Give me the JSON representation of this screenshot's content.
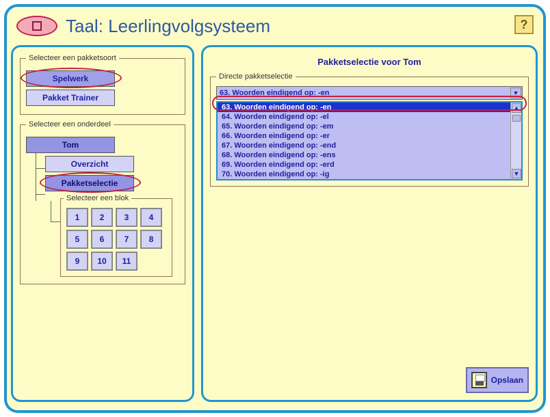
{
  "title": "Taal: Leerlingvolgsysteem",
  "help_label": "?",
  "left": {
    "fs1_legend": "Selecteer een pakketsoort",
    "btn_spelwerk": "Spelwerk",
    "btn_pakket_trainer": "Pakket Trainer",
    "fs2_legend": "Selecteer een onderdeel",
    "student": "Tom",
    "overzicht": "Overzicht",
    "pakketselectie": "Pakketselectie",
    "blok_legend": "Selecteer een blok",
    "blocks": [
      "1",
      "2",
      "3",
      "4",
      "5",
      "6",
      "7",
      "8",
      "9",
      "10",
      "11"
    ]
  },
  "right": {
    "title": "Pakketselectie voor  Tom",
    "fs_legend": "Directe pakketselectie",
    "combo_selected": "63. Woorden eindigend op: -en",
    "list": [
      "63. Woorden eindigend op: -en",
      "64. Woorden eindigend op: -el",
      "65. Woorden eindigend op: -em",
      "66. Woorden eindigend op: -er",
      "67. Woorden eindigend op: -end",
      "68. Woorden eindigend op: -ens",
      "69. Woorden eindigend op: -erd",
      "70. Woorden eindigend op: -ig"
    ],
    "save_label": "Opslaan"
  }
}
